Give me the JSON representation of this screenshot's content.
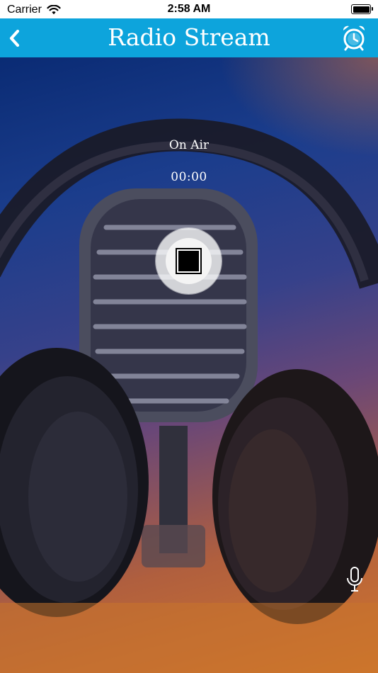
{
  "status_bar": {
    "carrier": "Carrier",
    "time": "2:58 AM"
  },
  "nav": {
    "title": "Radio Stream",
    "back_icon": "chevron-left-icon",
    "alarm_icon": "alarm-clock-icon"
  },
  "player": {
    "status": "On Air",
    "elapsed": "00:00",
    "control_icon": "stop-icon"
  },
  "footer": {
    "mic_icon": "microphone-icon"
  },
  "colors": {
    "nav_bar": "#0da4dc",
    "status_bar": "#ffffff",
    "text_on_hero": "#ffffff"
  }
}
